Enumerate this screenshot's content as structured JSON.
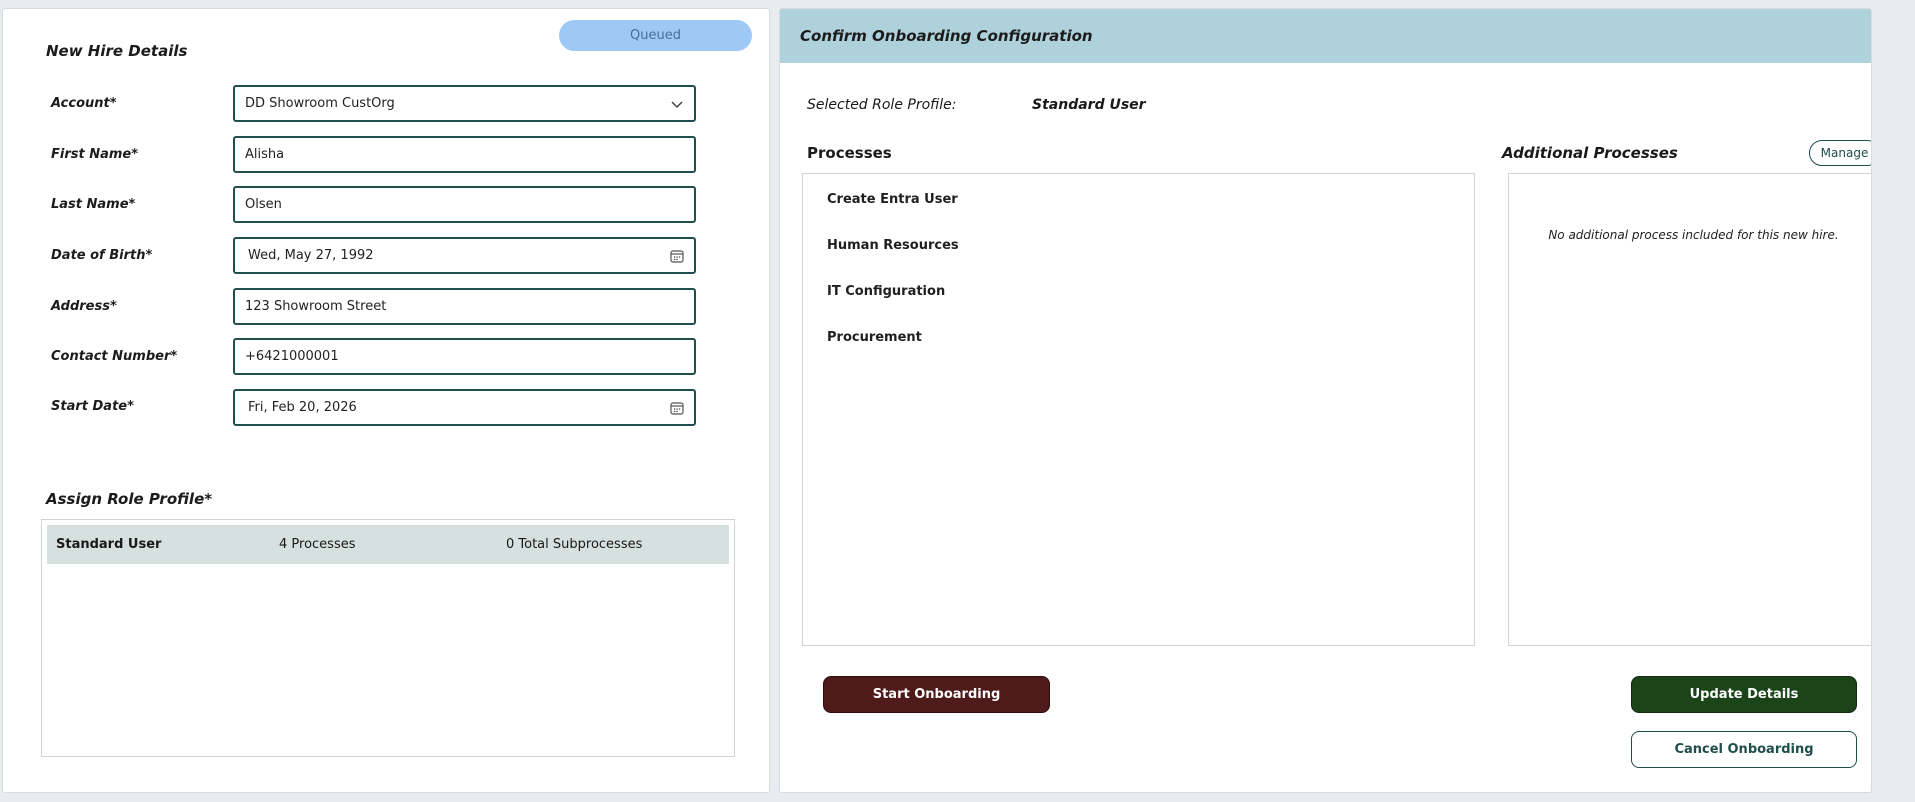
{
  "left": {
    "title": "New Hire Details",
    "status": "Queued",
    "fields": [
      {
        "label": "Account*",
        "value": "DD Showroom CustOrg"
      },
      {
        "label": "First Name*",
        "value": "Alisha"
      },
      {
        "label": "Last Name*",
        "value": "Olsen"
      },
      {
        "label": "Date of Birth*",
        "value": "Wed, May 27, 1992"
      },
      {
        "label": "Address*",
        "value": "123 Showroom Street"
      },
      {
        "label": "Contact Number*",
        "value": "+6421000001"
      },
      {
        "label": "Start Date*",
        "value": "Fri, Feb 20, 2026"
      }
    ],
    "role_title": "Assign Role Profile*",
    "role_rows": [
      {
        "name": "Standard User",
        "processes": "4 Processes",
        "subprocesses": "0 Total Subprocesses"
      }
    ]
  },
  "right": {
    "header": "Confirm Onboarding Configuration",
    "selected_role_label": "Selected Role Profile:",
    "selected_role_value": "Standard User",
    "processes_title": "Processes",
    "processes": [
      "Create Entra User",
      "Human Resources",
      "IT Configuration",
      "Procurement"
    ],
    "additional_title": "Additional Processes",
    "manage_label": "Manage",
    "additional_empty": "No additional process included for this new hire.",
    "start_label": "Start Onboarding",
    "update_label": "Update Details",
    "cancel_label": "Cancel Onboarding"
  },
  "icons": {
    "dropdown": "chevron-down-icon",
    "calendar": "calendar-icon"
  },
  "colors": {
    "accent_teal": "#1f4e4b",
    "header_blue": "#aed1db",
    "status_pill": "#9ec9f7",
    "start_button": "#4e1a1a",
    "update_button": "#1b4418"
  }
}
